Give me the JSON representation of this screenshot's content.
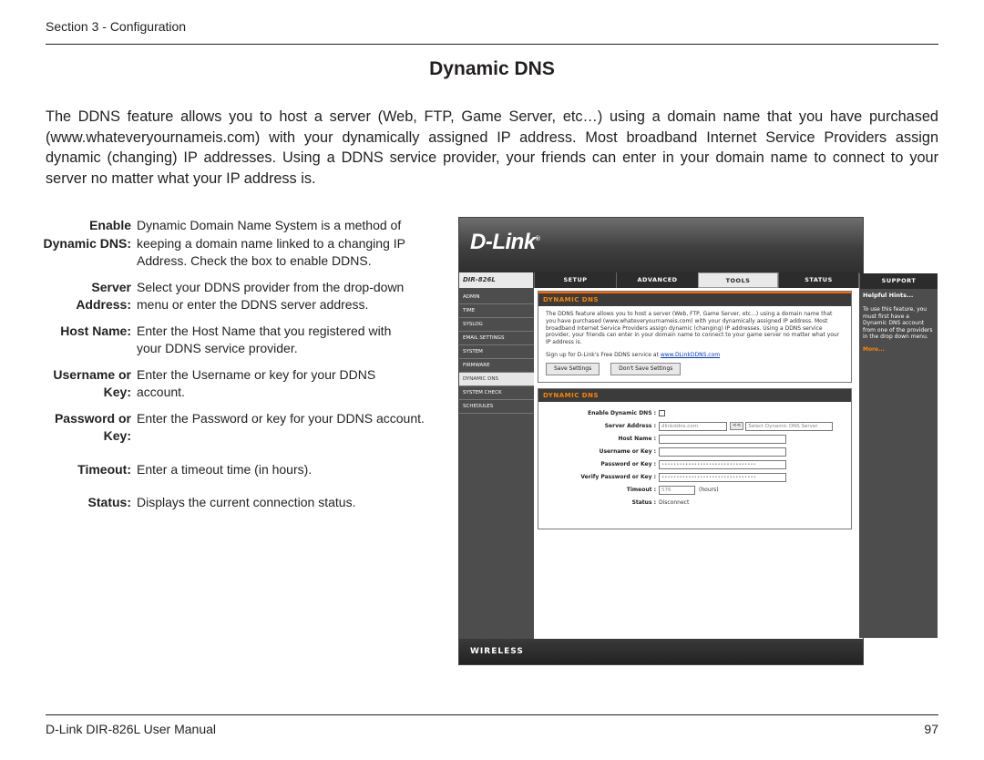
{
  "page": {
    "section": "Section 3 - Configuration",
    "title": "Dynamic DNS",
    "intro": "The DDNS feature allows you to host a server (Web, FTP, Game Server, etc…) using a domain name that you have purchased (www.whateveryournameis.com) with your dynamically assigned IP address. Most broadband Internet Service Providers assign dynamic (changing) IP addresses. Using a DDNS service provider, your friends can enter in your domain name to connect to your server no matter what your IP address is.",
    "footer_left": "D-Link DIR-826L User Manual",
    "footer_right": "97"
  },
  "definitions": [
    {
      "term1": "Enable",
      "term2": "Dynamic DNS:",
      "desc1": "Dynamic Domain Name System is a method of",
      "desc2": "keeping a domain name linked to a changing IP",
      "desc3": "Address. Check the box to enable DDNS."
    },
    {
      "term1": "Server",
      "term2": "Address:",
      "desc1": "Select your DDNS provider from the drop-down",
      "desc2": "menu or enter the DDNS server address."
    },
    {
      "term1": "Host Name:",
      "desc1": "Enter the Host Name that you registered with",
      "desc2": "your DDNS service provider."
    },
    {
      "term1": "Username or",
      "term2": "Key:",
      "desc1": "Enter the Username or key for your DDNS",
      "desc2": "account."
    },
    {
      "term1": "Password or",
      "term2": "Key:",
      "desc1": "Enter the Password or key for your DDNS account."
    },
    {
      "term1": "Timeout:",
      "desc1": "Enter a timeout time (in hours)."
    },
    {
      "term1": "Status:",
      "desc1": "Displays the current connection status."
    }
  ],
  "router": {
    "logo": "D-Link",
    "model": "DIR-826L",
    "tabs": [
      "SETUP",
      "ADVANCED",
      "TOOLS",
      "STATUS",
      "SUPPORT"
    ],
    "active_tab": "TOOLS",
    "sidebar": [
      "ADMIN",
      "TIME",
      "SYSLOG",
      "EMAIL SETTINGS",
      "SYSTEM",
      "FIRMWARE",
      "DYNAMIC DNS",
      "SYSTEM CHECK",
      "SCHEDULES"
    ],
    "active_sidebar": "DYNAMIC DNS",
    "panel1_title": "DYNAMIC DNS",
    "panel1_text": "The DDNS feature allows you to host a server (Web, FTP, Game Server, etc...) using a domain name that you have purchased (www.whateveryournameis.com) with your dynamically assigned IP address. Most broadband Internet Service Providers assign dynamic (changing) IP addresses. Using a DDNS service provider, your friends can enter in your domain name to connect to your game server no matter what your IP address is.",
    "signup_text": "Sign up for D-Link's Free DDNS service at",
    "signup_link": "www.DLinkDDNS.com",
    "save_button": "Save Settings",
    "dont_save_button": "Don't Save Settings",
    "panel2_title": "DYNAMIC DNS",
    "fields": {
      "enable_label": "Enable Dynamic DNS :",
      "server_label": "Server Address :",
      "server_value": "dlinkddns.com",
      "server_arrow": "<<",
      "server_select": "Select Dynamic DNS Server",
      "host_label": "Host Name :",
      "user_label": "Username or Key :",
      "pass_label": "Password or Key :",
      "pass_value": "••••••••••••••••••••••••••••••••",
      "verify_label": "Verify Password or Key :",
      "verify_value": "••••••••••••••••••••••••••••••••",
      "timeout_label": "Timeout :",
      "timeout_value": "576",
      "timeout_unit": "(hours)",
      "status_label": "Status :",
      "status_value": "Disconnect"
    },
    "hints_title": "Helpful Hints...",
    "hints_text": "To use this feature, you must first have a Dynamic DNS account from one of the providers in the drop down menu.",
    "hints_more": "More...",
    "footer": "WIRELESS"
  }
}
